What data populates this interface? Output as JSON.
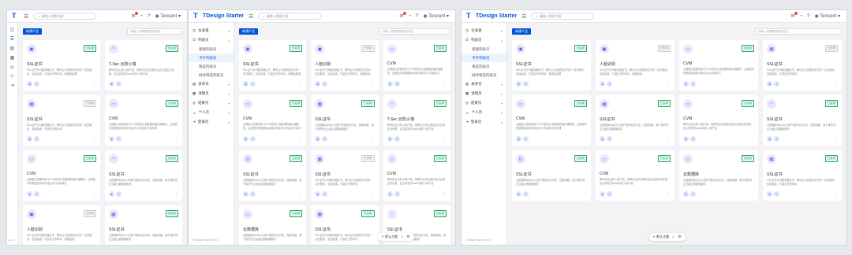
{
  "app": {
    "brand": "TDesign Starter",
    "search_placeholder": "请输入搜索内容",
    "user": "Tencent",
    "version": "TDesign Starter 0.6.0",
    "version_short": "v0.6.0"
  },
  "toolbar": {
    "add_label": "新建产品",
    "filter_placeholder": "请输入你需要搜索的内容"
  },
  "float_bar": {
    "theme_label": "默认主题"
  },
  "side_menu": {
    "groups": [
      {
        "label": "仪表盘"
      },
      {
        "label": "列表页"
      },
      {
        "label": "表单页"
      },
      {
        "label": "详情页"
      },
      {
        "label": "结果页"
      },
      {
        "label": "个人页"
      },
      {
        "label": "登录页"
      }
    ],
    "sub_items": [
      {
        "label": "基础列表页"
      },
      {
        "label": "卡片列表页"
      },
      {
        "label": "筛选列表页"
      },
      {
        "label": "树状筛选列表页"
      }
    ]
  },
  "cards": [
    {
      "title": "SSL证书",
      "status": "已启用",
      "enabled": true,
      "desc": "SSL证书又叫服务器证书，腾讯云为您提供证书的一站式服务，包括免费、付费证书的申请、管理及部署",
      "icon": "product-icon"
    },
    {
      "title": "人脸识别",
      "status": "已停用",
      "enabled": false,
      "desc": "SSL证书又叫服务器证书，腾讯云为您提供证书的一站式服务，包括免费、付费证书的申请、管理及部",
      "icon": "product-icon"
    },
    {
      "title": "CVM",
      "status": "已启用",
      "enabled": true,
      "desc": "云硬盘为您提供用于CVM的持久性数据块级存储服务。云硬盘中的数据自动地可用区内以多副本冗",
      "icon": "server-icon"
    },
    {
      "title": "SSL证书",
      "status": "已停用",
      "enabled": false,
      "desc": "SSL证书又叫服务器证书，腾讯云为您提供证书的一站式服务，包括免费、付费证书的申请",
      "icon": "calendar-icon"
    },
    {
      "title": "CVM",
      "status": "已启用",
      "enabled": true,
      "desc": "云硬盘为您提供用于CVM的持久性数据块级存储服务。云硬盘中的数据自动地可用区内以多副本冗余存储",
      "icon": "server-icon"
    },
    {
      "title": "SSL证书",
      "status": "已启用",
      "enabled": true,
      "desc": "云数据库MySQL为用户提供安全可靠，性能卓越、易于维护的企业级云数据库服务",
      "icon": "calendar-icon"
    },
    {
      "title": "T-Sec 云防火墙",
      "status": "已启用",
      "enabled": true,
      "desc": "腾讯安全云防火墙产品，是腾讯云安全团队结合云原生的优势，自主研发的SaaS化防火墙产品",
      "icon": "headset-icon"
    },
    {
      "title": "SSL证书",
      "status": "已启用",
      "enabled": true,
      "desc": "云数据库MySQL为用户提供安全可靠，性能卓越、易于维护的企业级云数据库服务",
      "icon": "headset-icon"
    },
    {
      "title": "SSL证书",
      "status": "已启用",
      "enabled": true,
      "desc": "云数据库MySQL为用户提供安全可靠，性能卓越、易于维护的企业级云数据库服务",
      "icon": "lock-icon"
    },
    {
      "title": "CVM",
      "status": "已启用",
      "enabled": true,
      "desc": "腾讯安全云防火墙产品，是腾讯云安全团队结合云原生的优势，自主研发的SaaS化防火墙产品",
      "icon": "server-icon"
    },
    {
      "title": "云数据库",
      "status": "已启用",
      "enabled": true,
      "desc": "云数据库MySQL为用户提供安全可靠，性能卓越、易于维护的企业级云数据库服务",
      "icon": "server-icon"
    },
    {
      "title": "SSL证书",
      "status": "已启用",
      "enabled": true,
      "desc": "SSL证书又叫服务器证书，腾讯云为您提供证书的一站式服务，包括免费、付费证书的申请",
      "icon": "calendar-icon"
    }
  ]
}
